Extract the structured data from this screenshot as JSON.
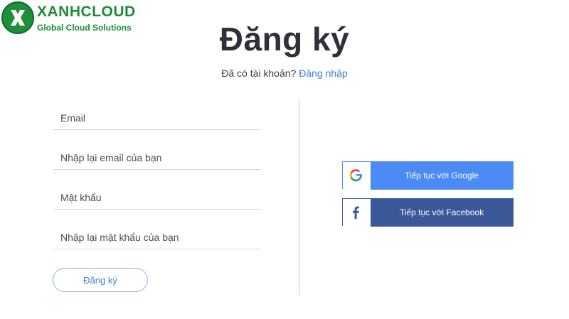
{
  "logo": {
    "name": "XANHCLOUD",
    "tagline": "Global Cloud Solutions",
    "colors": {
      "brand_green": "#1f8a3a"
    }
  },
  "page": {
    "title": "Đăng ký",
    "has_account_text": "Đã có tài khoản?",
    "login_link": "Đăng nhập"
  },
  "form": {
    "email_placeholder": "Email",
    "confirm_email_placeholder": "Nhập lại email của bạn",
    "password_placeholder": "Mật khẩu",
    "confirm_password_placeholder": "Nhập lại mật khẩu của bạn",
    "submit_label": "Đăng ký"
  },
  "social": {
    "google_label": "Tiếp tục với Google",
    "google_icon": "google-g-icon",
    "facebook_label": "Tiếp tục với Facebook",
    "facebook_icon": "facebook-f-icon",
    "colors": {
      "google": "#4c8bf5",
      "facebook": "#3b5998",
      "link": "#3c7fd6"
    }
  }
}
